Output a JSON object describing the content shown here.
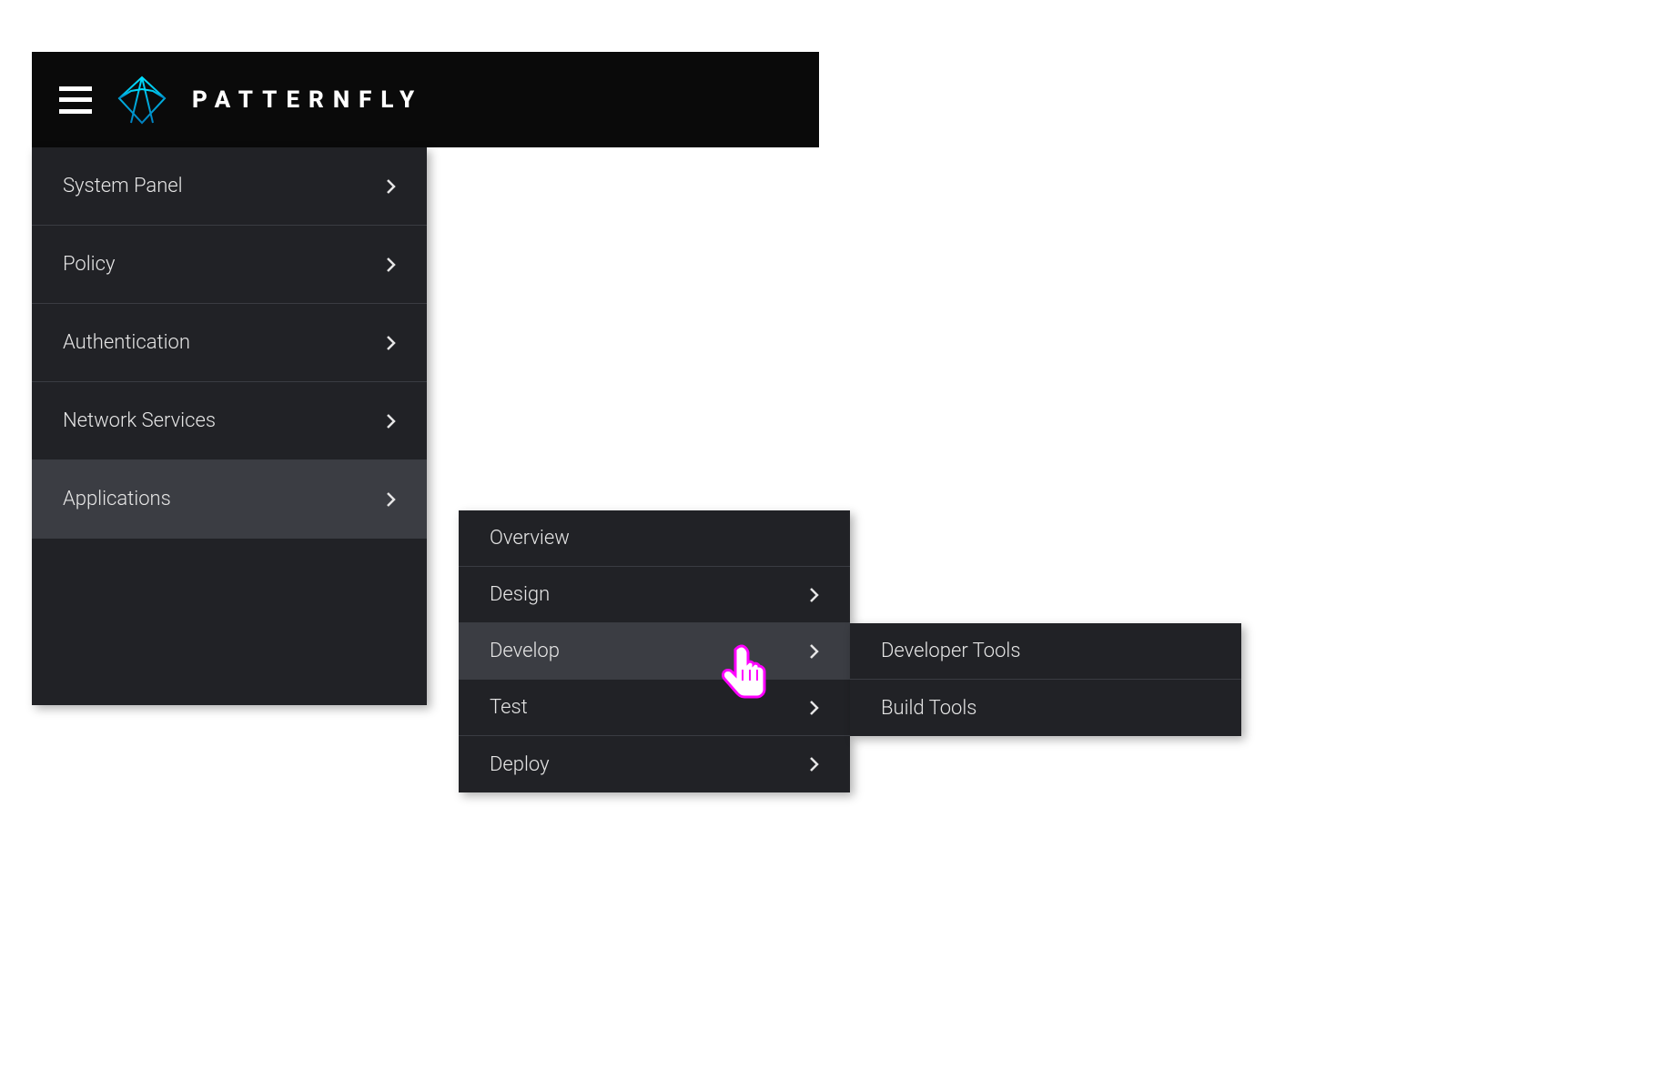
{
  "header": {
    "brand": "PATTERNFLY"
  },
  "sidebar": {
    "items": [
      {
        "label": "System Panel",
        "hasChildren": true,
        "hover": false
      },
      {
        "label": "Policy",
        "hasChildren": true,
        "hover": false
      },
      {
        "label": "Authentication",
        "hasChildren": true,
        "hover": false
      },
      {
        "label": "Network Services",
        "hasChildren": true,
        "hover": false
      },
      {
        "label": "Applications",
        "hasChildren": true,
        "hover": true
      }
    ]
  },
  "submenu1": {
    "items": [
      {
        "label": "Overview",
        "hasChildren": false,
        "hover": false
      },
      {
        "label": "Design",
        "hasChildren": true,
        "hover": false
      },
      {
        "label": "Develop",
        "hasChildren": true,
        "hover": true
      },
      {
        "label": "Test",
        "hasChildren": true,
        "hover": false
      },
      {
        "label": "Deploy",
        "hasChildren": true,
        "hover": false
      }
    ]
  },
  "submenu2": {
    "items": [
      {
        "label": "Developer Tools",
        "hasChildren": false,
        "hover": false
      },
      {
        "label": "Build Tools",
        "hasChildren": false,
        "hover": false
      }
    ]
  },
  "colors": {
    "headerBg": "#0a0a0a",
    "panelBg": "#212226",
    "hoverBg": "#3b3d43",
    "divider": "#3a3c42",
    "text": "#e6e6e6",
    "logoGradStart": "#00d4ff",
    "logoGradEnd": "#0088cc"
  }
}
